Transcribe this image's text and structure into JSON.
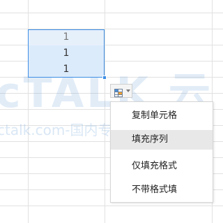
{
  "cells": {
    "values": [
      "1",
      "1",
      "1"
    ]
  },
  "autofill_button": {
    "icon": "autofill-options-icon",
    "chevron_icon": "chevron-down-icon"
  },
  "menu": {
    "items": [
      {
        "label": "复制单元格",
        "active": false
      },
      {
        "label": "填充序列",
        "active": true
      },
      {
        "label": "仅填充格式",
        "active": false
      },
      {
        "label": "不带格式填",
        "active": false
      }
    ]
  },
  "watermark": {
    "main": "cTALK 云",
    "sub": "ctalk.com-国内专业云计算交流"
  },
  "colors": {
    "selection_fill": "#dcebfb",
    "selection_border": "#3e8ee5",
    "grid_line": "#e1e1e1",
    "menu_active": "#e8e8e8"
  }
}
